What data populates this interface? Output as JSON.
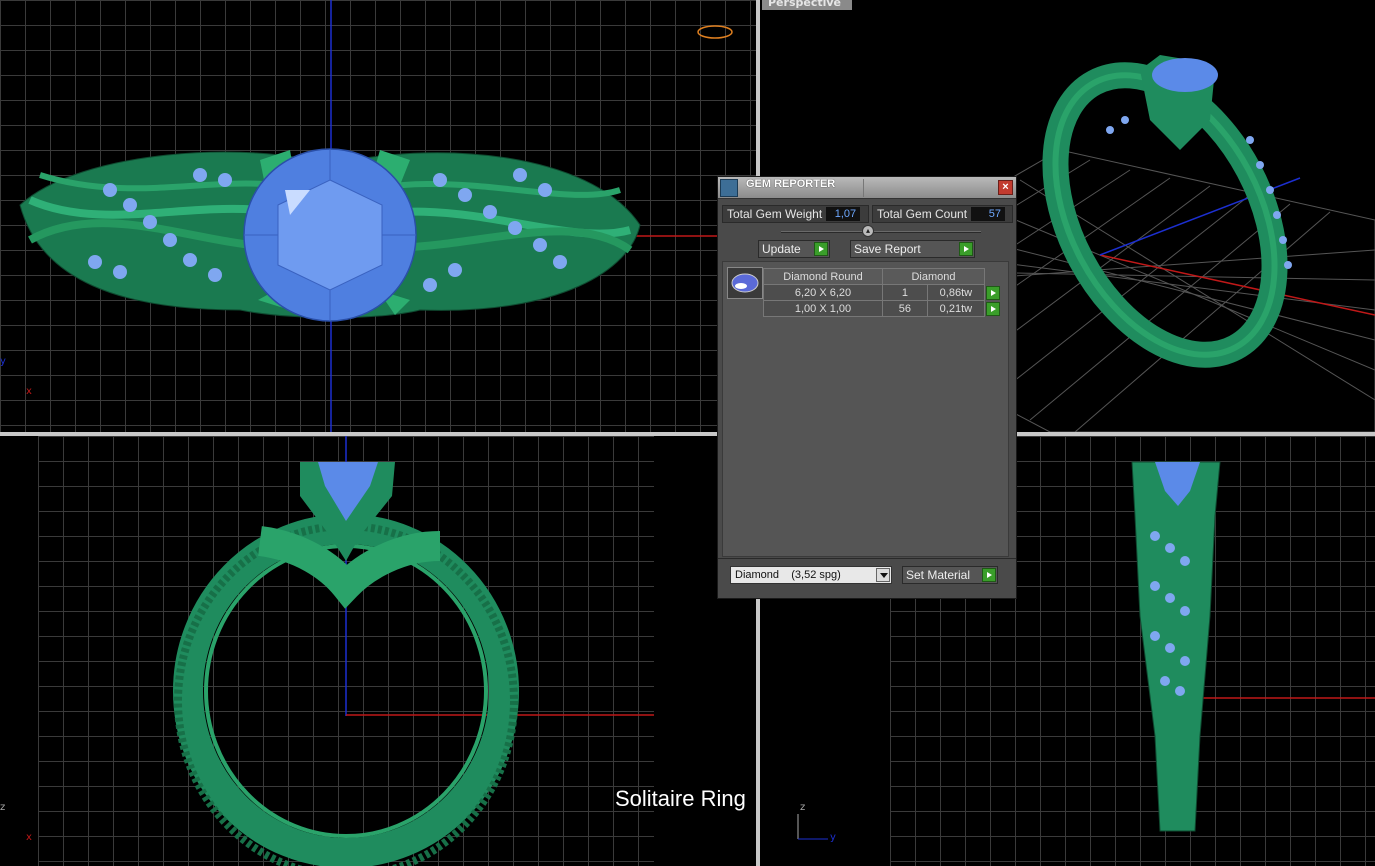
{
  "viewports": {
    "top": {
      "axis_x": "x",
      "axis_y": "y"
    },
    "perspective": {
      "label": "Perspective"
    },
    "front": {
      "axis_x": "x",
      "axis_z": "z"
    },
    "side": {
      "axis_y": "y",
      "axis_z": "z"
    }
  },
  "caption": "Solitaire Ring",
  "colors": {
    "ring": "#1f8c5e",
    "gem": "#5b8ae8",
    "grid": "#3a3a3a",
    "axis_red": "#c01818",
    "axis_blue": "#1c2fd0"
  },
  "gem_reporter": {
    "title": "GEM REPORTER",
    "close_icon": "close-icon",
    "total_weight_label": "Total Gem Weight",
    "total_weight_value": "1,07",
    "total_count_label": "Total Gem Count",
    "total_count_value": "57",
    "update_label": "Update",
    "save_report_label": "Save Report",
    "table": {
      "headers": [
        "Diamond Round",
        "Diamond"
      ],
      "rows": [
        {
          "size": "6,20 X 6,20",
          "count": "1",
          "weight": "0,86tw"
        },
        {
          "size": "1,00 X 1,00",
          "count": "56",
          "weight": "0,21tw"
        }
      ]
    },
    "material_value": "Diamond    (3,52 spg)",
    "set_material_label": "Set Material"
  }
}
